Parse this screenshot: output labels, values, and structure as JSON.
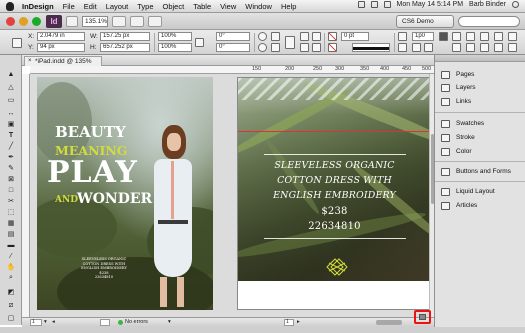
{
  "menubar": {
    "app_name": "InDesign",
    "items": [
      "File",
      "Edit",
      "Layout",
      "Type",
      "Object",
      "Table",
      "View",
      "Window",
      "Help"
    ],
    "clock": "Mon May 14  5:14 PM",
    "user": "Barb Binder"
  },
  "appbar": {
    "logo": "Id",
    "zoom": "135.1%",
    "workspace": "CS6 Demo"
  },
  "control": {
    "x_label": "X:",
    "x_value": "2.0479 in",
    "y_label": "Y:",
    "y_value": "94 px",
    "w_label": "W:",
    "w_value": "157.25 px",
    "h_label": "H:",
    "h_value": "657.252 px",
    "scale_x": "100%",
    "scale_y": "100%",
    "rotate": "0°",
    "shear": "0°",
    "stroke_weight": "0 pt",
    "other_value": "1p0"
  },
  "document": {
    "tab_label": "*iPad.indd @ 135%",
    "ruler_numbers": [
      "150",
      "200",
      "250",
      "300",
      "350",
      "400",
      "450",
      "500"
    ]
  },
  "left_page": {
    "headline_1": "BEAUTY",
    "headline_2": "MEANING",
    "headline_3": "PLAY",
    "headline_4": "AND",
    "headline_5": "WONDER",
    "caption_lines": [
      "SLEEVELESS ORGANIC",
      "COTTON DRESS WITH",
      "ENGLISH EMBROIDERY",
      "$238",
      "22634810"
    ]
  },
  "right_page": {
    "line_1": "SLEEVELESS ORGANIC",
    "line_2": "COTTON DRESS WITH",
    "line_3": "ENGLISH EMBROIDERY",
    "price": "$238",
    "sku": "22634810"
  },
  "status": {
    "page_num": "1",
    "errors": "No errors",
    "page_num_right": "1"
  },
  "panels": {
    "group1": [
      "Pages",
      "Layers",
      "Links"
    ],
    "group2": [
      "Swatches",
      "Stroke",
      "Color"
    ],
    "group3": [
      "Buttons and Forms"
    ],
    "group4": [
      "Liquid Layout",
      "Articles"
    ]
  },
  "colors": {
    "accent_yellow": "#d2dc3c",
    "highlight_red": "#e11111"
  }
}
